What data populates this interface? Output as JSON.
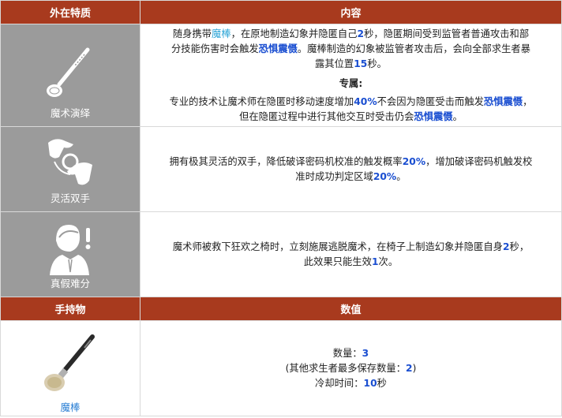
{
  "headers": {
    "trait": "外在特质",
    "content": "内容",
    "item": "手持物",
    "value": "数值"
  },
  "traits": [
    {
      "name": "魔术演绎",
      "icon": "magic-wand-icon",
      "p1_a": "随身携带",
      "p1_link": "魔棒",
      "p1_b": "，在原地制造幻象并隐匿自己",
      "p1_n1": "2",
      "p1_c": "秒，隐匿期间受到监管者普通攻击和部分技能伤害时会触发",
      "p1_k1": "恐惧震慑",
      "p1_d": "。魔棒制造的幻象被监管者攻击后，会向全部求生者暴露其位置",
      "p1_n2": "15",
      "p1_e": "秒。",
      "sub_title": "专属:",
      "p2_a": "专业的技术让魔术师在隐匿时移动速度增加",
      "p2_n1": "40%",
      "p2_b": "不会因为隐匿受击而触发",
      "p2_k1": "恐惧震慑",
      "p2_c": "，但在隐匿过程中进行其他交互时受击仍会",
      "p2_k2": "恐惧震慑",
      "p2_d": "。"
    },
    {
      "name": "灵活双手",
      "icon": "hands-icon",
      "t_a": "拥有极其灵活的双手，降低破译密码机校准的触发概率",
      "t_n1": "20%",
      "t_b": "，增加破译密码机触发校准时成功判定区域",
      "t_n2": "20%",
      "t_c": "。"
    },
    {
      "name": "真假难分",
      "icon": "person-exclamation-icon",
      "t_a": "魔术师被救下狂欢之椅时，立刻施展逃脱魔术，在椅子上制造幻象并隐匿自身",
      "t_n1": "2",
      "t_b": "秒，此效果只能生效",
      "t_n2": "1",
      "t_c": "次。"
    }
  ],
  "item": {
    "name": "魔棒",
    "icon": "magic-wand-item-icon",
    "count_label": "数量：",
    "count_value": "3",
    "store_a": "(其他求生者最多保存数量：",
    "store_value": "2",
    "store_b": ")",
    "cd_label": "冷却时间：",
    "cd_value": "10",
    "cd_unit": "秒"
  },
  "colors": {
    "header": "#a83a1e",
    "trait_bg": "#9b9b9b",
    "keyword_blue": "#1b4fd1",
    "link_cyan": "#2aa4d6"
  }
}
